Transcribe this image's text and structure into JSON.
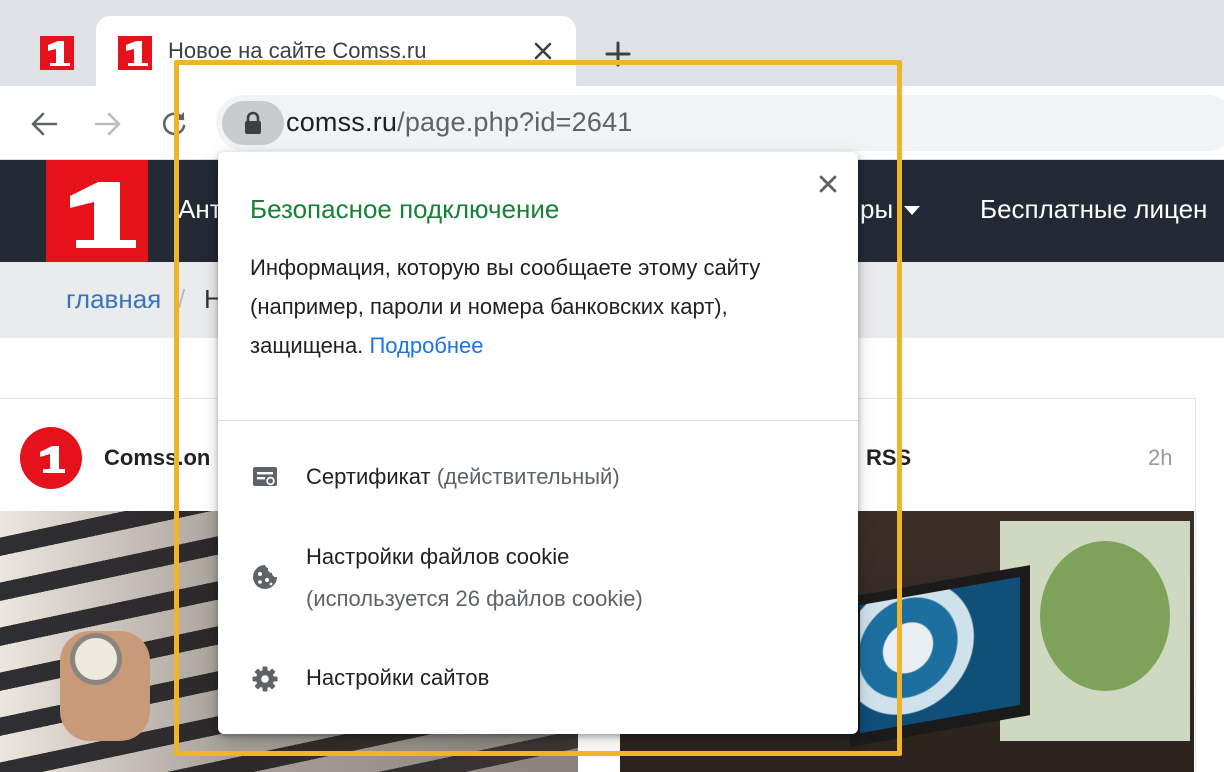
{
  "colors": {
    "brand_red": "#e5121b",
    "secure_green": "#188038",
    "link_blue": "#1a73e8",
    "highlight_orange": "#f0b429",
    "site_nav_bg": "#232a35"
  },
  "tabs": {
    "pinned": {
      "icon": "site-favicon"
    },
    "active": {
      "title": "Новое на сайте Comss.ru",
      "icon": "site-favicon"
    },
    "close_icon": "close-icon",
    "new_tab_icon": "plus-icon"
  },
  "toolbar": {
    "back_icon": "arrow-left-icon",
    "forward_icon": "arrow-right-icon",
    "reload_icon": "reload-icon",
    "lock_icon": "lock-icon",
    "url_host": "comss.ru",
    "url_path": "/page.php?id=2641"
  },
  "site": {
    "nav": {
      "item_1": "Ант",
      "item_2": "ры",
      "item_3": "Бесплатные лицен"
    },
    "breadcrumb": {
      "home": "главная",
      "separator": "/",
      "current": "Н"
    },
    "card": {
      "author": "Comss.on",
      "source": "RSS",
      "time": "2h"
    }
  },
  "popup": {
    "title": "Безопасное подключение",
    "description": "Информация, которую вы сообщаете этому сайту (например, пароли и номера банковских карт), защищена.",
    "learn_more": "Подробнее",
    "rows": [
      {
        "icon": "certificate-icon",
        "label": "Сертификат",
        "sub": "(действительный)"
      },
      {
        "icon": "cookie-icon",
        "label": "Настройки файлов cookie",
        "sub": "(используется 26 файлов cookie)"
      },
      {
        "icon": "gear-icon",
        "label": "Настройки сайтов",
        "sub": ""
      }
    ]
  }
}
